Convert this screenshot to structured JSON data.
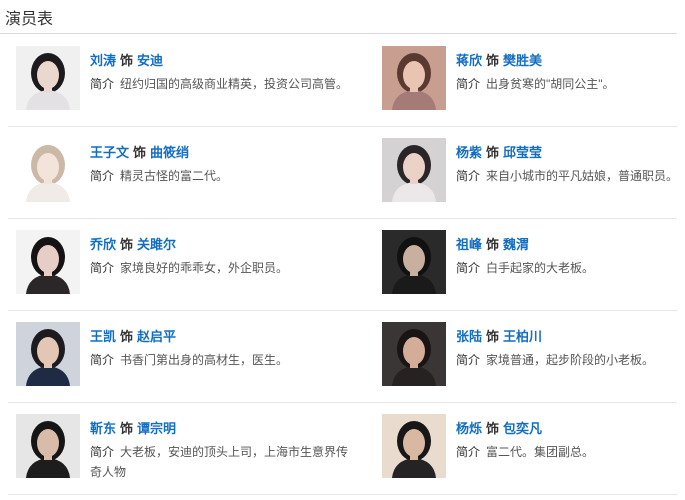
{
  "section": {
    "title": "演员表"
  },
  "cast": [
    {
      "actor": "刘涛",
      "shi": "饰",
      "role": "安迪",
      "intro_label": "简介",
      "intro": "纽约归国的高级商业精英，投资公司高管。",
      "photo": {
        "bg": "#f0f0f0",
        "hair": "#1c1a1d",
        "skin": "#ead7cd",
        "cloth": "#e4e1e4"
      }
    },
    {
      "actor": "蒋欣",
      "shi": "饰",
      "role": "樊胜美",
      "intro_label": "简介",
      "intro": "出身贫寒的\"胡同公主\"。",
      "photo": {
        "bg": "#c89e90",
        "hair": "#5a3a30",
        "skin": "#e9c4b3",
        "cloth": "#a57b78"
      }
    },
    {
      "actor": "王子文",
      "shi": "饰",
      "role": "曲筱绡",
      "intro_label": "简介",
      "intro": "精灵古怪的富二代。",
      "photo": {
        "bg": "#ffffff",
        "hair": "#cbb9a6",
        "skin": "#f2e4da",
        "cloth": "#f0ebe7"
      }
    },
    {
      "actor": "杨紫",
      "shi": "饰",
      "role": "邱莹莹",
      "intro_label": "简介",
      "intro": "来自小城市的平凡姑娘，普通职员。",
      "photo": {
        "bg": "#d5d2d4",
        "hair": "#2a2526",
        "skin": "#ecd2c6",
        "cloth": "#ece8e9"
      }
    },
    {
      "actor": "乔欣",
      "shi": "饰",
      "role": "关雎尔",
      "intro_label": "简介",
      "intro": "家境良好的乖乖女，外企职员。",
      "photo": {
        "bg": "#f3f3f3",
        "hair": "#151213",
        "skin": "#e6cdc5",
        "cloth": "#2b2627"
      }
    },
    {
      "actor": "祖峰",
      "shi": "饰",
      "role": "魏渭",
      "intro_label": "简介",
      "intro": "白手起家的大老板。",
      "photo": {
        "bg": "#2a2a2a",
        "hair": "#111111",
        "skin": "#c9b09e",
        "cloth": "#1a1a1a"
      }
    },
    {
      "actor": "王凯",
      "shi": "饰",
      "role": "赵启平",
      "intro_label": "简介",
      "intro": "书香门第出身的高材生，医生。",
      "photo": {
        "bg": "#cfd3db",
        "hair": "#1b1b20",
        "skin": "#e3c6b3",
        "cloth": "#1f2a44"
      }
    },
    {
      "actor": "张陆",
      "shi": "饰",
      "role": "王柏川",
      "intro_label": "简介",
      "intro": "家境普通，起步阶段的小老板。",
      "photo": {
        "bg": "#3a3636",
        "hair": "#1a1515",
        "skin": "#d3ad97",
        "cloth": "#262222"
      }
    },
    {
      "actor": "靳东",
      "shi": "饰",
      "role": "谭宗明",
      "intro_label": "简介",
      "intro": "大老板，安迪的顶头上司，上海市生意界传奇人物",
      "photo": {
        "bg": "#e6e6e6",
        "hair": "#151515",
        "skin": "#d8bba8",
        "cloth": "#1d1d1d"
      }
    },
    {
      "actor": "杨烁",
      "shi": "饰",
      "role": "包奕凡",
      "intro_label": "简介",
      "intro": "富二代。集团副总。",
      "photo": {
        "bg": "#e9dccf",
        "hair": "#181617",
        "skin": "#d9b8a1",
        "cloth": "#262325"
      }
    }
  ]
}
